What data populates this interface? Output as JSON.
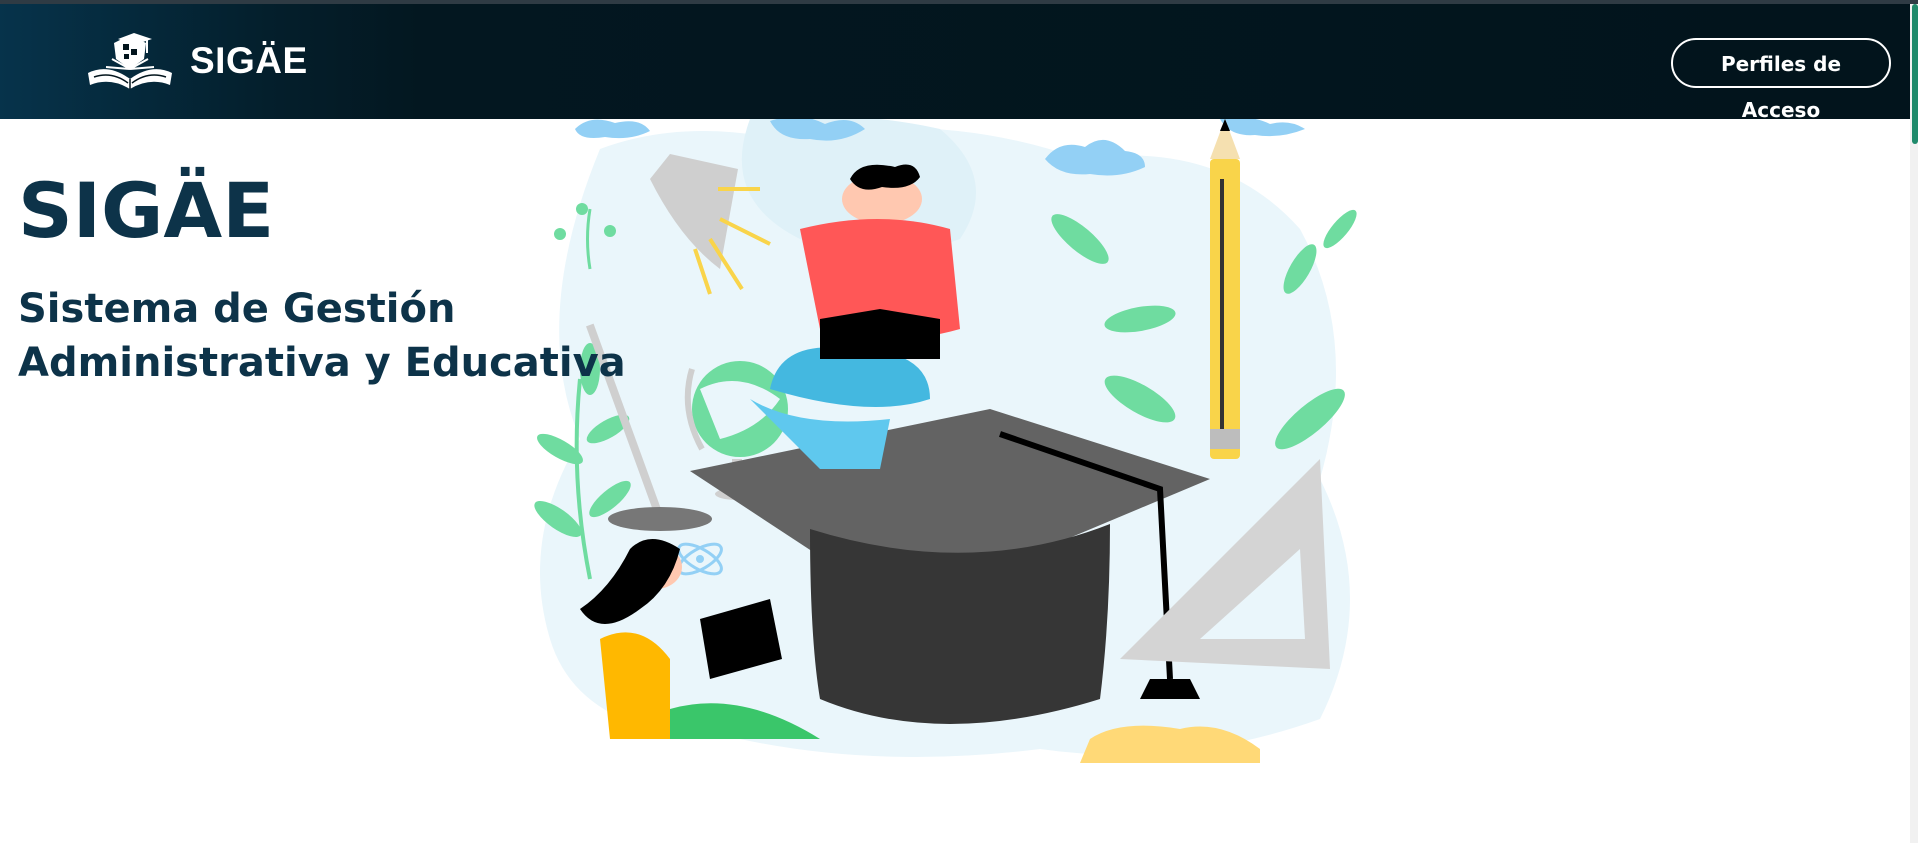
{
  "navbar": {
    "brand_name": "SIGÄE",
    "logo_icon": "graduation-cap-book-icon",
    "access_button_label": "Perfiles de Acceso"
  },
  "hero": {
    "title": "SIGÄE",
    "subtitle": "Sistema de Gestión Administrativa y Educativa",
    "illustration": "students-studying-graduation-cap-illustration"
  },
  "colors": {
    "navbar_dark": "#02141c",
    "navbar_accent": "#06334b",
    "heading": "#0d3349",
    "scroll_thumb": "#1f8a6b"
  }
}
